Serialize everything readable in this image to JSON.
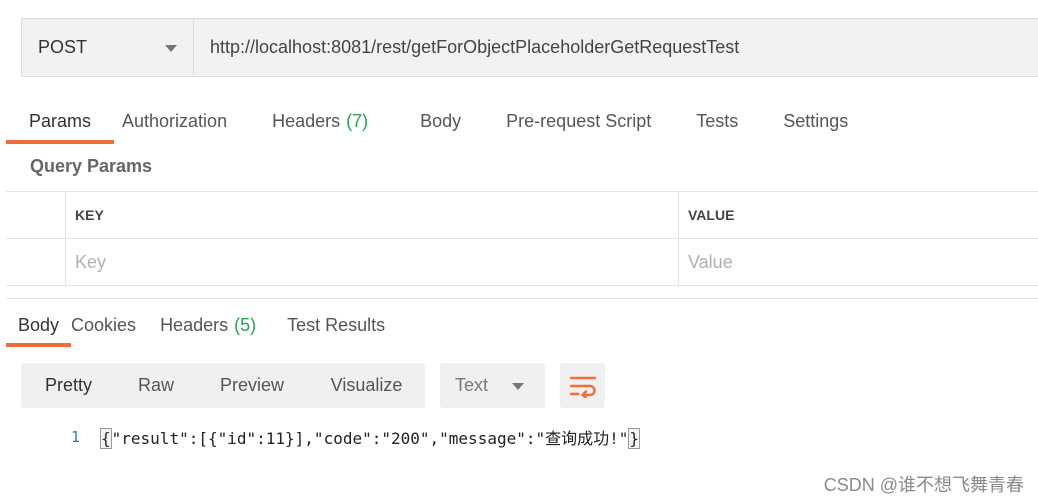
{
  "request": {
    "method": "POST",
    "url": "http://localhost:8081/rest/getForObjectPlaceholderGetRequestTest"
  },
  "request_tabs": [
    {
      "label": "Params",
      "count": "",
      "active": true
    },
    {
      "label": "Authorization",
      "count": ""
    },
    {
      "label": "Headers",
      "count": "(7)"
    },
    {
      "label": "Body",
      "count": ""
    },
    {
      "label": "Pre-request Script",
      "count": ""
    },
    {
      "label": "Tests",
      "count": ""
    },
    {
      "label": "Settings",
      "count": ""
    }
  ],
  "query_params": {
    "title": "Query Params",
    "columns": {
      "key": "KEY",
      "value": "VALUE"
    },
    "placeholders": {
      "key": "Key",
      "value": "Value"
    }
  },
  "response_tabs": [
    {
      "label": "Body",
      "count": "",
      "active": true
    },
    {
      "label": "Cookies",
      "count": ""
    },
    {
      "label": "Headers",
      "count": "(5)"
    },
    {
      "label": "Test Results",
      "count": ""
    }
  ],
  "view_modes": [
    "Pretty",
    "Raw",
    "Preview",
    "Visualize"
  ],
  "format": "Text",
  "response_body": {
    "line_number": "1",
    "open_brace": "{",
    "content": "\"result\":[{\"id\":11}],\"code\":\"200\",\"message\":\"查询成功!\"",
    "close_brace": "}"
  },
  "watermark": "CSDN @谁不想飞舞青春",
  "colors": {
    "accent": "#f26b3a",
    "count": "#26a352",
    "line_number": "#2e7bb3"
  },
  "icons": {
    "wrap": "wrap-lines-icon",
    "caret": "chevron-down-icon"
  }
}
